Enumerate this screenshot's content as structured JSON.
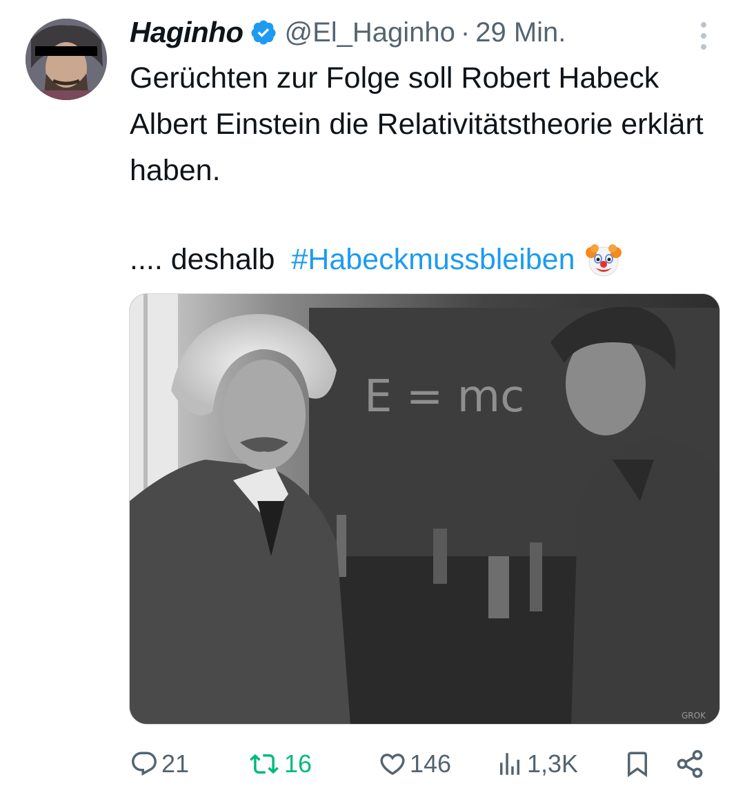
{
  "tweet": {
    "author": {
      "display_name": "Haginho",
      "handle": "@El_Haginho",
      "verified": true
    },
    "separator": "·",
    "time": "29 Min.",
    "text_line_1": "Gerüchten zur Folge soll Robert Habeck Albert Einstein die Relativitätstheorie erklärt haben.",
    "text_prefix": ".... deshalb",
    "hashtag": "#Habeckmussbleiben",
    "emoji": "clown-face",
    "media": {
      "chalkboard_text": "E = mc",
      "watermark": "GROK"
    },
    "stats": {
      "replies": "21",
      "retweets": "16",
      "likes": "146",
      "views": "1,3K"
    }
  },
  "colors": {
    "text": "#0f1419",
    "muted": "#536471",
    "link": "#1d9bf0",
    "retweet": "#00ba7c",
    "verified": "#1d9bf0"
  }
}
